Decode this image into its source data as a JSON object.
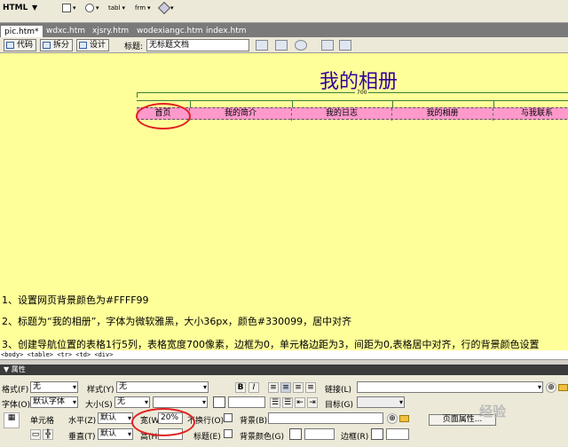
{
  "insert_bar": {
    "mode": "HTML",
    "tools": [
      {
        "label": "",
        "icon": "layout-icon"
      },
      {
        "label": "",
        "icon": "image-icon"
      },
      {
        "label": "tabl",
        "icon": "table-icon"
      },
      {
        "label": "frm",
        "icon": "form-icon"
      },
      {
        "label": "",
        "icon": "asset-icon"
      }
    ]
  },
  "doc_tabs": [
    "pic.htm*",
    "wdxc.htm",
    "xjsry.htm",
    "wodexiangc.htm",
    "index.htm"
  ],
  "doc_toolbar": {
    "code_label": "代码",
    "split_label": "拆分",
    "design_label": "设计",
    "title_label": "标题:",
    "title_value": "无标题文档"
  },
  "design": {
    "page_title": "我的相册",
    "width_label": "700",
    "nav": [
      {
        "label": "首页",
        "w": 60
      },
      {
        "label": "我的简介",
        "w": 115
      },
      {
        "label": "我的日志",
        "w": 113
      },
      {
        "label": "我的相册",
        "w": 114
      },
      {
        "label": "与我联系",
        "w": 98
      }
    ],
    "notes": [
      "1、设置网页背景颜色为#FFFF99",
      "2、标题为“我的相册”，字体为微软雅黑，大小36px，颜色#330099，居中对齐",
      "3、创建导航位置的表格1行5列，表格宽度700像素，边框为0，单元格边距为3，间距为0,表格居中对齐，行的背景颜色设置"
    ]
  },
  "tag_selector": "<body> <table> <tr> <td> <div>",
  "properties": {
    "header": "▼ 属性",
    "format_label": "格式(F)",
    "format_value": "无",
    "style_label": "样式(Y)",
    "style_value": "无",
    "bold": "B",
    "italic": "I",
    "link_label": "链接(L)",
    "font_label": "字体(O)",
    "font_value": "默认字体",
    "size_label": "大小(S)",
    "size_value": "无",
    "target_label": "目标(G)",
    "cell_label": "单元格",
    "horz_label": "水平(Z)",
    "horz_value": "默认",
    "width_label": "宽(W)",
    "width_value": "20%",
    "nowrap_label": "不换行(O)",
    "bg_label": "背景(B)",
    "page_props": "页面属性...",
    "vert_label": "垂直(T)",
    "vert_value": "默认",
    "height_label": "高(H)",
    "header_label": "标题(E)",
    "bgcolor_label": "背景颜色(G)",
    "border_label": "边框(R)",
    "watermark": "经验"
  },
  "colors": {
    "page_bg": "#ffff99",
    "title": "#330099",
    "nav_bg": "#ff99cc",
    "highlight": "#e02020"
  }
}
